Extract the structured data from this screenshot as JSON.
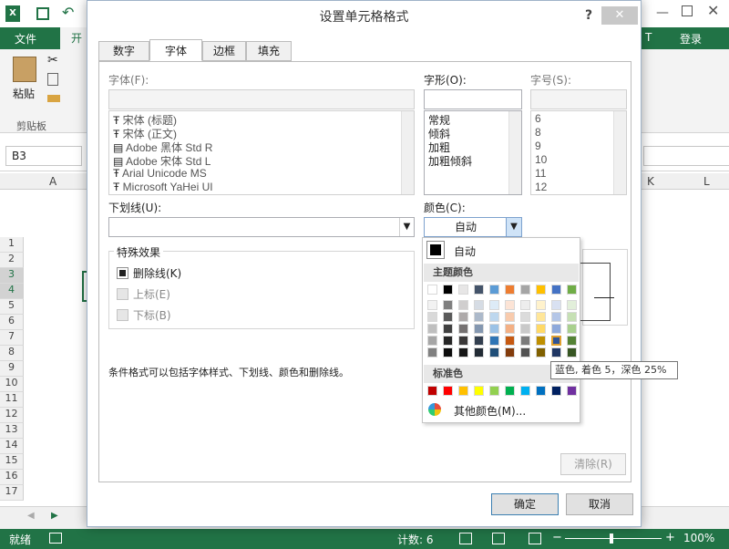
{
  "excel": {
    "tab_file": "文件",
    "tab_home_partial": "开始",
    "tab_partial_right": "T",
    "login": "登录",
    "paste": "粘贴",
    "clipboard": "剪贴板",
    "name_box": "B3",
    "col_a": "A",
    "col_k": "K",
    "col_l": "L",
    "rows": [
      "1",
      "2",
      "3",
      "4",
      "5",
      "6",
      "7",
      "8",
      "9",
      "10",
      "11",
      "12",
      "13",
      "14",
      "15",
      "16",
      "17"
    ],
    "status_ready": "就绪",
    "status_count": "计数: 6",
    "zoom": "100%"
  },
  "dialog": {
    "title": "设置单元格格式",
    "help": "?",
    "tabs": [
      "数字",
      "字体",
      "边框",
      "填充"
    ],
    "font_label": "字体(F):",
    "fonts": [
      "宋体 (标题)",
      "宋体 (正文)",
      "Adobe 黑体 Std R",
      "Adobe 宋体 Std L",
      "Arial Unicode MS",
      "Microsoft YaHei UI"
    ],
    "style_label": "字形(O):",
    "styles": [
      "常规",
      "倾斜",
      "加粗",
      "加粗倾斜"
    ],
    "size_label": "字号(S):",
    "sizes": [
      "6",
      "8",
      "9",
      "10",
      "11",
      "12"
    ],
    "underline_label": "下划线(U):",
    "color_label": "颜色(C):",
    "color_value": "自动",
    "effects_legend": "特殊效果",
    "strikethrough": "删除线(K)",
    "superscript": "上标(E)",
    "subscript": "下标(B)",
    "note": "条件格式可以包括字体样式、下划线、颜色和删除线。",
    "clear": "清除(R)",
    "ok": "确定",
    "cancel": "取消"
  },
  "color_popup": {
    "auto": "自动",
    "theme_title": "主题颜色",
    "standard_title": "标准色",
    "more": "其他颜色(M)...",
    "tooltip": "蓝色, 着色 5，深色 25%",
    "theme_top": [
      "#ffffff",
      "#000000",
      "#e7e6e6",
      "#44546a",
      "#5b9bd5",
      "#ed7d31",
      "#a5a5a5",
      "#ffc000",
      "#4472c4",
      "#70ad47"
    ],
    "theme_shades": [
      [
        "#f2f2f2",
        "#7f7f7f",
        "#d0cece",
        "#d6dce4",
        "#ddebf7",
        "#fce4d6",
        "#ededed",
        "#fff2cc",
        "#d9e1f2",
        "#e2efda"
      ],
      [
        "#d9d9d9",
        "#595959",
        "#aeaaaa",
        "#acb9ca",
        "#bdd7ee",
        "#f8cbad",
        "#dbdbdb",
        "#ffe699",
        "#b4c6e7",
        "#c6e0b4"
      ],
      [
        "#bfbfbf",
        "#404040",
        "#757171",
        "#8497b0",
        "#9bc2e6",
        "#f4b084",
        "#c9c9c9",
        "#ffd966",
        "#8ea9db",
        "#a9d08e"
      ],
      [
        "#a6a6a6",
        "#262626",
        "#3a3838",
        "#333f4f",
        "#2f75b5",
        "#c65911",
        "#7b7b7b",
        "#bf8f00",
        "#305496",
        "#548235"
      ],
      [
        "#808080",
        "#0d0d0d",
        "#161616",
        "#222b35",
        "#1f4e78",
        "#833c0c",
        "#525252",
        "#806000",
        "#203764",
        "#375623"
      ]
    ],
    "standard": [
      "#c00000",
      "#ff0000",
      "#ffc000",
      "#ffff00",
      "#92d050",
      "#00b050",
      "#00b0f0",
      "#0070c0",
      "#002060",
      "#7030a0"
    ]
  }
}
